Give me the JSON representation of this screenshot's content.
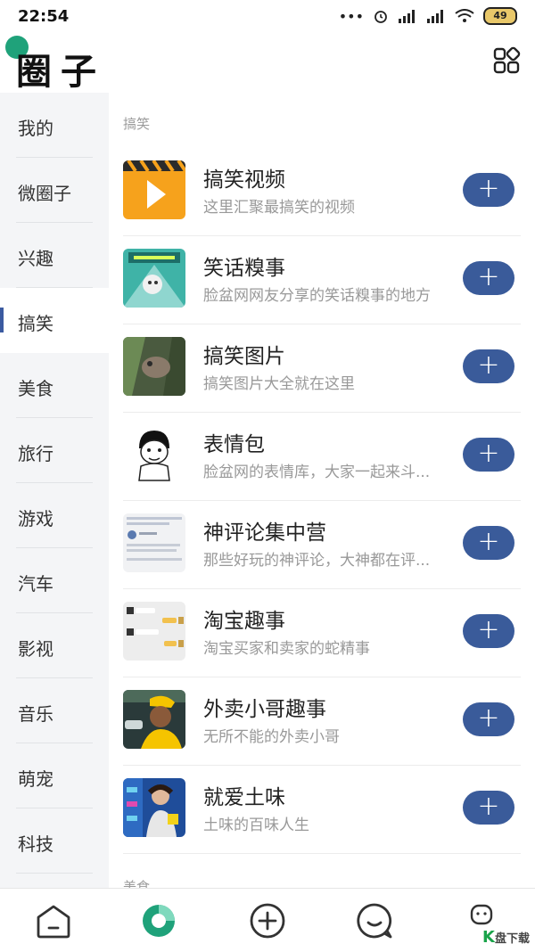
{
  "status": {
    "time": "22:54",
    "battery": "49"
  },
  "header": {
    "title": "圈子"
  },
  "sidebar": {
    "items": [
      {
        "label": "我的"
      },
      {
        "label": "微圈子"
      },
      {
        "label": "兴趣"
      },
      {
        "label": "搞笑",
        "active": true
      },
      {
        "label": "美食"
      },
      {
        "label": "旅行"
      },
      {
        "label": "游戏"
      },
      {
        "label": "汽车"
      },
      {
        "label": "影视"
      },
      {
        "label": "音乐"
      },
      {
        "label": "萌宠"
      },
      {
        "label": "科技"
      }
    ]
  },
  "main": {
    "section": "搞笑",
    "next_section": "美食",
    "add_label": "+",
    "rows": [
      {
        "name": "搞笑视频",
        "desc": "这里汇聚最搞笑的视频",
        "thumb": "play-thumbnail"
      },
      {
        "name": "笑话糗事",
        "desc": "脸盆网网友分享的笑话糗事的地方",
        "thumb": "joke-thumbnail"
      },
      {
        "name": "搞笑图片",
        "desc": "搞笑图片大全就在这里",
        "thumb": "animal-photo-thumbnail"
      },
      {
        "name": "表情包",
        "desc": "脸盆网的表情库，大家一起来斗...",
        "thumb": "meme-face-thumbnail"
      },
      {
        "name": "神评论集中营",
        "desc": "那些好玩的神评论，大神都在评...",
        "thumb": "comment-screenshot-thumbnail"
      },
      {
        "name": "淘宝趣事",
        "desc": "淘宝买家和卖家的蛇精事",
        "thumb": "chat-screenshot-thumbnail"
      },
      {
        "name": "外卖小哥趣事",
        "desc": "无所不能的外卖小哥",
        "thumb": "delivery-photo-thumbnail"
      },
      {
        "name": "就爱土味",
        "desc": "土味的百味人生",
        "thumb": "poster-thumbnail"
      }
    ]
  },
  "watermark": {
    "brand": "K",
    "text": "盘下载"
  },
  "colors": {
    "accent": "#3a5b9a",
    "green": "#1fa27a"
  }
}
